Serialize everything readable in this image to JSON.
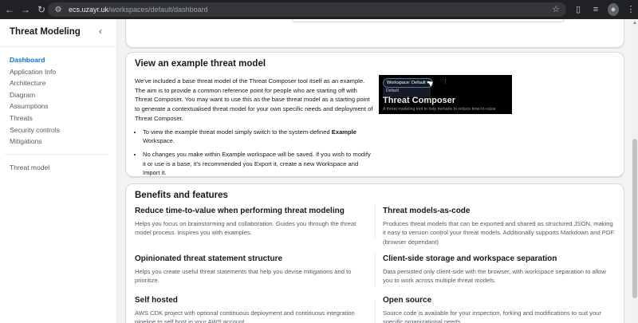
{
  "browser": {
    "url_host": "ecs.uzayr.uk",
    "url_path": "/workspaces/default/dashboard",
    "icons": [
      "back-icon",
      "forward-icon",
      "reload-icon",
      "site-settings-icon",
      "star-icon",
      "extensions-icon",
      "reading-list-icon",
      "profile-icon",
      "menu-icon"
    ]
  },
  "sidebar": {
    "title": "Threat Modeling",
    "items": [
      {
        "label": "Dashboard",
        "active": true
      },
      {
        "label": "Application Info"
      },
      {
        "label": "Architecture"
      },
      {
        "label": "Diagram"
      },
      {
        "label": "Assumptions"
      },
      {
        "label": "Threats"
      },
      {
        "label": "Security controls"
      },
      {
        "label": "Mitigations"
      }
    ],
    "extra": "Threat model"
  },
  "example": {
    "title": "View an example threat model",
    "intro": "We've included a base threat model of the Threat Composer tool itself as an example. The aim is to provide a common reference point for people who are starting off with Threat Composer. You may want to use this as the base threat model as a starting point to generate a contextualised threat model for your own specific needs and deployment of Threat Composer.",
    "bullet1_pre": "To view the example threat model simply switch to the system-defined ",
    "bullet1_bold": "Example",
    "bullet1_post": " Workspace.",
    "bullet2": "No changes you make within Example workspace will be saved. If you wish to modify it or use is a base, it's recommended you Export it, create a new Workspace and Import it.",
    "preview": {
      "workspace_label": "Workspace: Default",
      "option": "Default",
      "app_title": "Threat Composer",
      "tagline": "A threat modeling tool to help humans to reduce time-to-value"
    }
  },
  "benefits": {
    "title": "Benefits and features",
    "features": [
      {
        "heading": "Reduce time-to-value when performing threat modeling",
        "desc": "Helps you focus on brainstorming and collaboration. Guides you through the threat model process. Inspires you with examples."
      },
      {
        "heading": "Threat models-as-code",
        "desc": "Produces threat models that can be exported and shared as structured JSON, making it easy to version control your threat models. Additionally supports Markdown and PDF (browser dependant)"
      },
      {
        "heading": "Opinionated threat statement structure",
        "desc": "Helps you create useful threat statements that help you devise mitigations and to prioritize."
      },
      {
        "heading": "Client-side storage and workspace separation",
        "desc": "Data persisted only client-side with the browser, with workspace separation to allow you to work across multiple threat models."
      },
      {
        "heading": "Self hosted",
        "desc": "AWS CDK project with optional continuous deployment and continuous integration pipeline to self host in your AWS account."
      },
      {
        "heading": "Open source",
        "desc": "Source code is available for your inspection, forking and modifications to suit your specific organizational needs."
      }
    ]
  }
}
